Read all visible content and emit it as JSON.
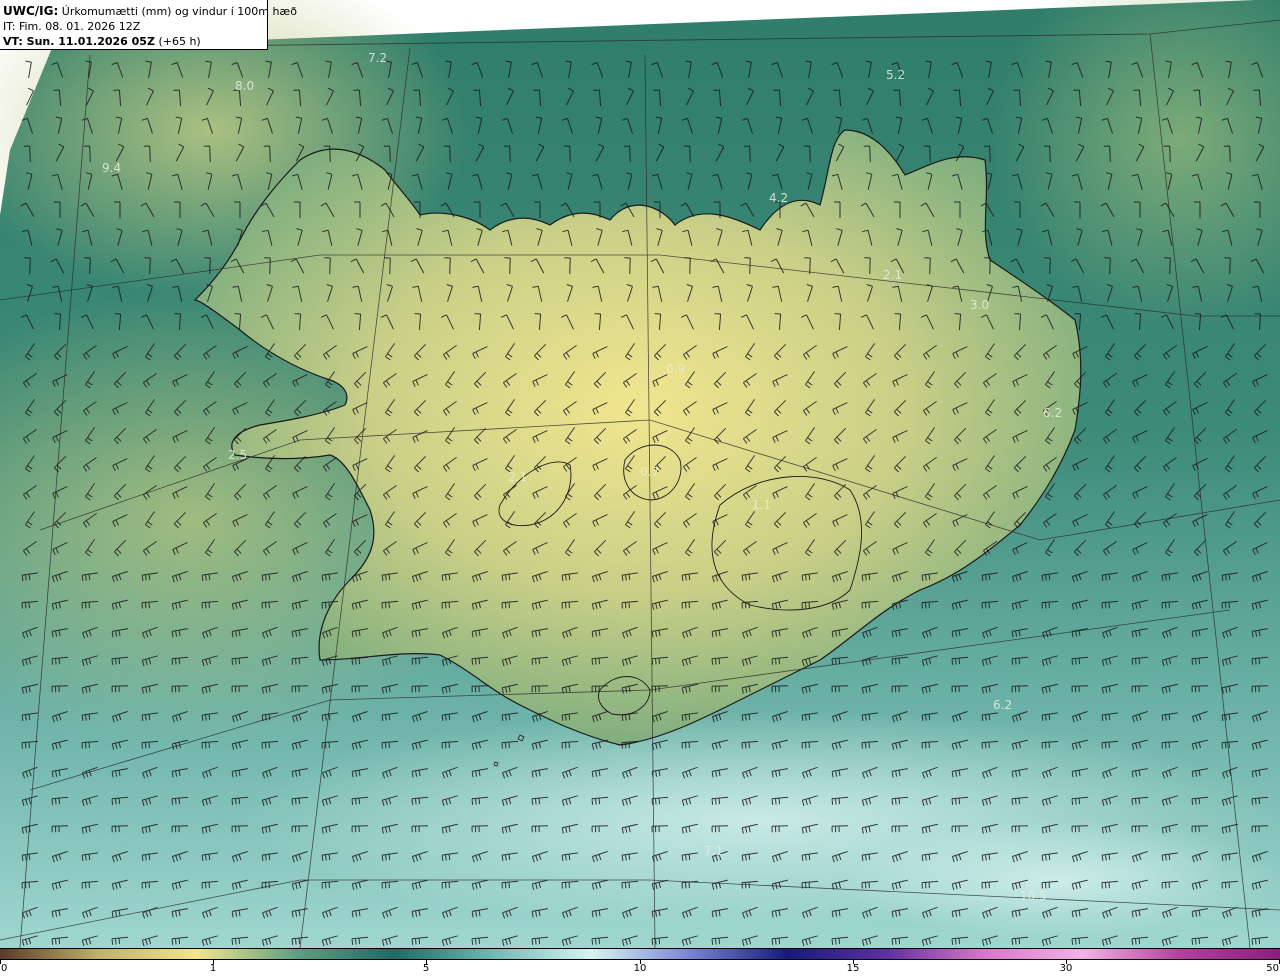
{
  "header": {
    "line1_bold": "UWC/IG:",
    "line1_text": "Úrkomumætti (mm) og vindur í 100m hæð",
    "line2_text": "IT: Fim. 08. 01. 2026 12Z",
    "line3_bold": "VT: Sun. 11.01.2026 05Z",
    "line3_text": "(+65 h)"
  },
  "map_values": [
    "7.2",
    "8.0",
    "5.2",
    "9.4",
    "4.2",
    "2.1",
    "3.0",
    "6.2",
    "0.9",
    "2.5",
    "0.7",
    "1.1",
    "2.1",
    "6.2",
    "7.1",
    "10.5"
  ],
  "colorbar": {
    "tick_labels": [
      "0",
      "1",
      "5",
      "10",
      "15",
      "30",
      "50"
    ],
    "colors": [
      "#5a3b2a",
      "#bfb26b",
      "#f3e58c",
      "#5fa083",
      "#1f6a66",
      "#6fb9b4",
      "#d8f4f2",
      "#7a86d4",
      "#141c78",
      "#5d2fa0",
      "#d877c9",
      "#f2b2e6",
      "#b0409c",
      "#8a1f7a"
    ]
  }
}
